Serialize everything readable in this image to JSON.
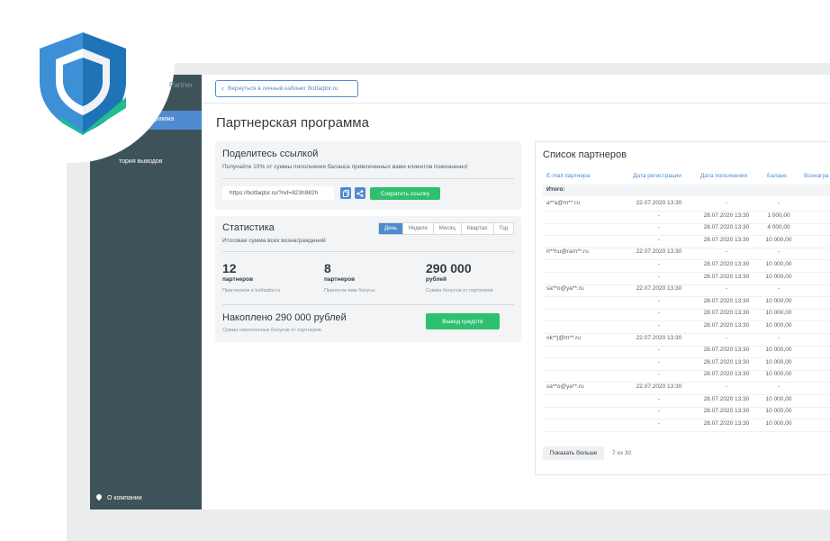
{
  "brand": {
    "partner_label": "Partner"
  },
  "sidebar": {
    "active_item": "рамма",
    "sub_item": "",
    "history_item": "тория выводов",
    "about_item": "О компании"
  },
  "topbar": {
    "back_label": "Вернуться в личный кабинет Botfaqtor.ru"
  },
  "page": {
    "title": "Партнерская программа"
  },
  "share": {
    "title": "Поделитесь ссылкой",
    "subtitle": "Получайте 10% от суммы пополнения баланса привлеченных вами клиентов пожизненно!",
    "url": "https://botfaqtor.ru/?ref=823h982h",
    "shorten_label": "Сократить ссылку"
  },
  "stats": {
    "title": "Статистика",
    "subtitle": "Итоговая сумма всех вознаграждений",
    "periods": [
      "День",
      "Неделя",
      "Месяц",
      "Квартал",
      "Год"
    ],
    "active_period": "День",
    "items": [
      {
        "value": "12",
        "unit": "партнеров",
        "note": "Пригласили в botfaqtor.ru"
      },
      {
        "value": "8",
        "unit": "партнеров",
        "note": "Принесли вам бонусы"
      },
      {
        "value": "290 000",
        "unit": "рублей",
        "note": "Сумма бонусов от партнеров"
      }
    ],
    "accumulated_title": "Накоплено 290 000 рублей",
    "accumulated_sub": "Сумма накопленных бонусов от партнеров",
    "withdraw_label": "Вывод средств"
  },
  "partners": {
    "title": "Список партнеров",
    "columns": [
      "E-mail партнера",
      "Дата регистрации",
      "Дата пополнения",
      "Баланс",
      "Вознагра"
    ],
    "total_label": "Итого:",
    "rows": [
      [
        "a**a@m**.ru",
        "22.07.2020 13:30",
        "-",
        "-"
      ],
      [
        "",
        "-",
        "28.07.2020 13:30",
        "1 000,00"
      ],
      [
        "",
        "-",
        "28.07.2020 13:30",
        "4 000,00"
      ],
      [
        "",
        "-",
        "28.07.2020 13:30",
        "10 000,00"
      ],
      [
        "rt**hu@ram**.ru",
        "22.07.2020 13:30",
        "-",
        "-"
      ],
      [
        "",
        "-",
        "28.07.2020 13:30",
        "10 000,00"
      ],
      [
        "",
        "-",
        "28.07.2020 13:30",
        "10 000,00"
      ],
      [
        "sa**o@ya**.ru",
        "22.07.2020 13:30",
        "-",
        "-"
      ],
      [
        "",
        "-",
        "28.07.2020 13:30",
        "10 000,00"
      ],
      [
        "",
        "-",
        "28.07.2020 13:30",
        "10 000,00"
      ],
      [
        "",
        "-",
        "28.07.2020 13:30",
        "10 000,00"
      ],
      [
        "ok**j@m**.ru",
        "22.07.2020 13:30",
        "-",
        "-"
      ],
      [
        "",
        "-",
        "28.07.2020 13:30",
        "10 000,00"
      ],
      [
        "",
        "-",
        "28.07.2020 13:30",
        "10 000,00"
      ],
      [
        "",
        "-",
        "28.07.2020 13:30",
        "10 000,00"
      ],
      [
        "sa**o@ya**.ru",
        "22.07.2020 13:30",
        "-",
        "-"
      ],
      [
        "",
        "-",
        "28.07.2020 13:30",
        "10 000,00"
      ],
      [
        "",
        "-",
        "28.07.2020 13:30",
        "10 000,00"
      ],
      [
        "",
        "-",
        "28.07.2020 13:30",
        "10 000,00"
      ]
    ],
    "show_more_label": "Показать больше",
    "pagination": "7 из 30"
  },
  "colors": {
    "accent": "#4f8bd0",
    "success": "#2ec06f",
    "sidebar": "#3e5259",
    "shield_light": "#3d8fd6",
    "shield_dark": "#1f73b7",
    "shield_check": "#1fbd8f"
  }
}
